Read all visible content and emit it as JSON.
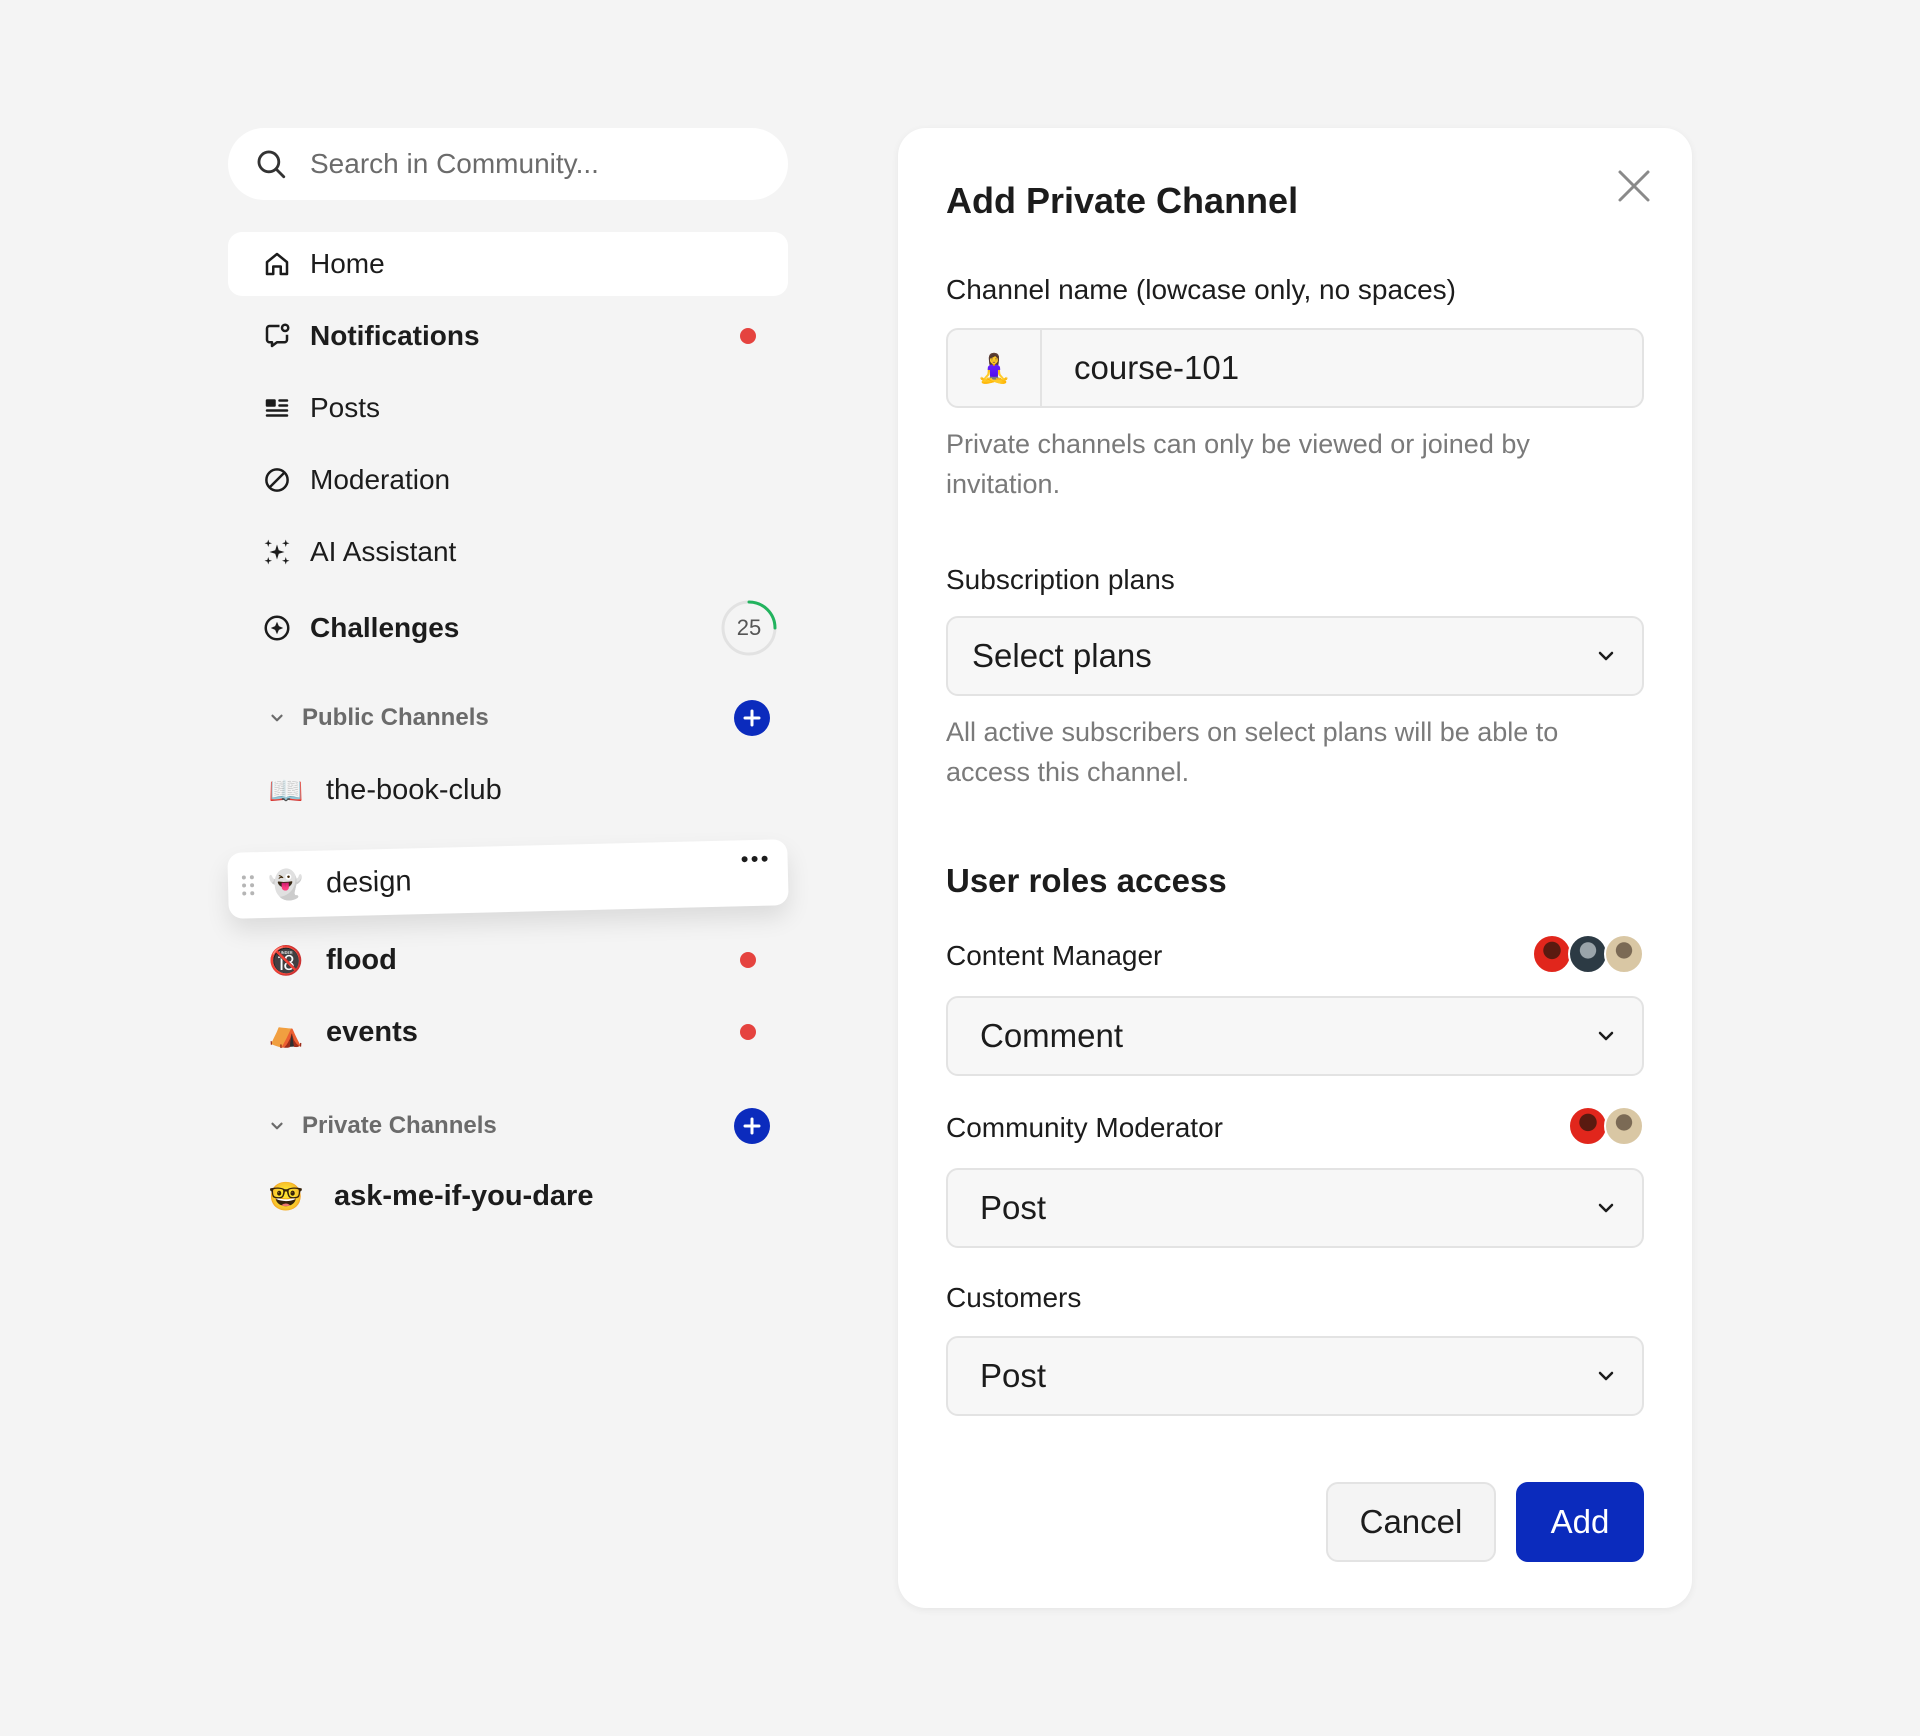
{
  "search": {
    "placeholder": "Search in Community..."
  },
  "nav": {
    "home": "Home",
    "notifications": "Notifications",
    "posts": "Posts",
    "moderation": "Moderation",
    "ai_assistant": "AI Assistant",
    "challenges": "Challenges",
    "challenges_count": "25"
  },
  "public_channels": {
    "title": "Public Channels",
    "items": [
      {
        "emoji": "📖",
        "label": "the-book-club"
      },
      {
        "emoji": "👻",
        "label": "design"
      },
      {
        "emoji": "🔞",
        "label": "flood"
      },
      {
        "emoji": "⛺",
        "label": "events"
      }
    ]
  },
  "private_channels": {
    "title": "Private Channels",
    "items": [
      {
        "emoji": "🤓",
        "label": "ask-me-if-you-dare"
      }
    ]
  },
  "modal": {
    "title": "Add Private Channel",
    "name_label": "Channel name (lowcase only, no spaces)",
    "name_emoji": "🧘‍♀️",
    "name_value": "course-101",
    "name_help": "Private channels can only be viewed or joined by invitation.",
    "plans_label": "Subscription plans",
    "plans_value": "Select plans",
    "plans_help": "All active subscribers on select plans will be able to access this channel.",
    "roles_title": "User roles access",
    "roles": [
      {
        "label": "Content Manager",
        "value": "Comment"
      },
      {
        "label": "Community Moderator",
        "value": "Post"
      },
      {
        "label": "Customers",
        "value": "Post"
      }
    ],
    "cancel": "Cancel",
    "add": "Add"
  },
  "colors": {
    "accent": "#0b2bbd",
    "notification_dot": "#e5433f",
    "progress": "#22b35e"
  }
}
